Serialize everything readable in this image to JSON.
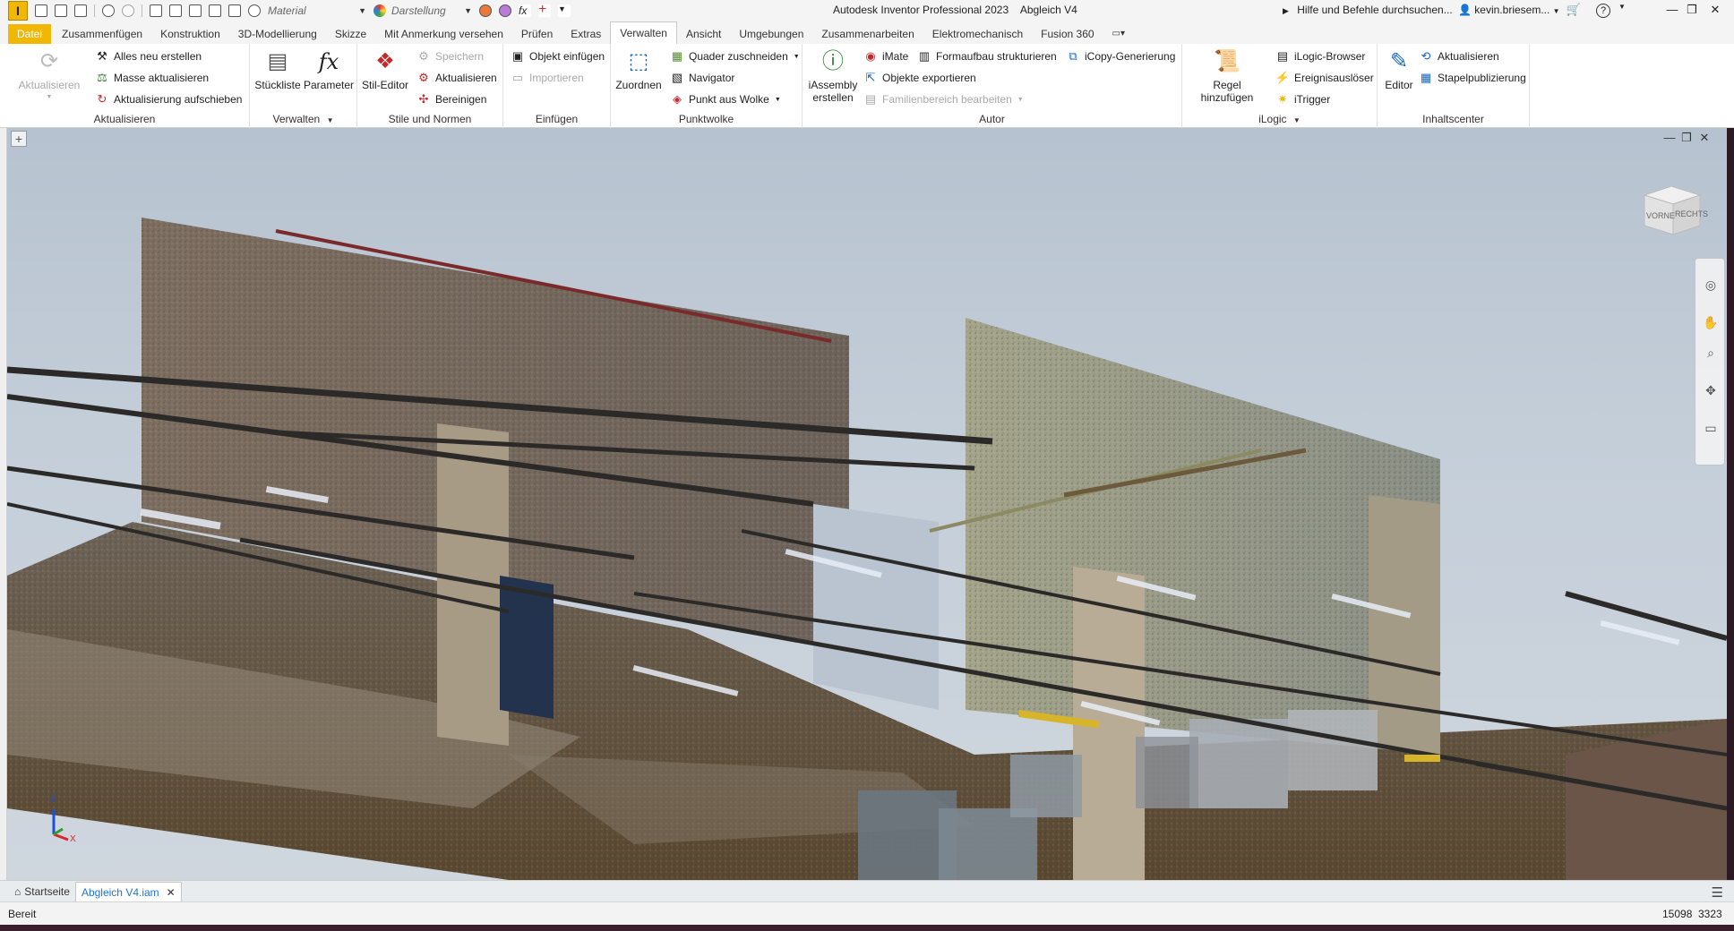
{
  "titlebar": {
    "app_title": "Autodesk Inventor Professional 2023",
    "doc_title": "Abgleich V4",
    "material_label": "Material",
    "appearance_label": "Darstellung",
    "help_search": "Hilfe und Befehle durchsuchen...",
    "user": "kevin.briesem..."
  },
  "tabs": [
    "Datei",
    "Zusammenfügen",
    "Konstruktion",
    "3D-Modellierung",
    "Skizze",
    "Mit Anmerkung versehen",
    "Prüfen",
    "Extras",
    "Verwalten",
    "Ansicht",
    "Umgebungen",
    "Zusammenarbeiten",
    "Elektromechanisch",
    "Fusion 360"
  ],
  "active_tab": "Verwalten",
  "ribbon": {
    "aktualisieren": {
      "title": "Aktualisieren",
      "big": "Aktualisieren",
      "items": [
        "Alles neu erstellen",
        "Masse aktualisieren",
        "Aktualisierung aufschieben"
      ]
    },
    "verwalten": {
      "title": "Verwalten",
      "buttons": [
        "Stückliste",
        "Parameter"
      ]
    },
    "stile": {
      "title": "Stile und Normen",
      "big": "Stil-Editor",
      "items": [
        "Speichern",
        "Aktualisieren",
        "Bereinigen"
      ]
    },
    "einfuegen": {
      "title": "Einfügen",
      "items": [
        "Objekt einfügen",
        "Importieren"
      ]
    },
    "punktwolke": {
      "title": "Punktwolke",
      "big": "Zuordnen",
      "items": [
        "Quader zuschneiden",
        "Navigator",
        "Punkt aus Wolke"
      ]
    },
    "autor": {
      "title": "Autor",
      "big": "iAssembly erstellen",
      "items": [
        "iMate",
        "Formaufbau strukturieren",
        "iCopy-Generierung",
        "Objekte exportieren",
        "Familienbereich bearbeiten"
      ]
    },
    "ilogic": {
      "title": "iLogic",
      "big": "Regel hinzufügen",
      "items": [
        "iLogic-Browser",
        "Ereignisauslöser",
        "iTrigger"
      ]
    },
    "inhaltscenter": {
      "title": "Inhaltscenter",
      "big": "Editor",
      "items": [
        "Aktualisieren",
        "Stapelpublizierung"
      ]
    }
  },
  "viewcube": {
    "front": "VORNE",
    "right": "RECHTS"
  },
  "triad": {
    "z": "Z",
    "x": "X"
  },
  "doc_tabs": [
    {
      "label": "Startseite",
      "active": false
    },
    {
      "label": "Abgleich V4.iam",
      "active": true
    }
  ],
  "status": {
    "text": "Bereit",
    "num1": "15098",
    "num2": "3323"
  },
  "colors": {
    "accent": "#f2b705",
    "active_doc": "#1f74d2"
  }
}
